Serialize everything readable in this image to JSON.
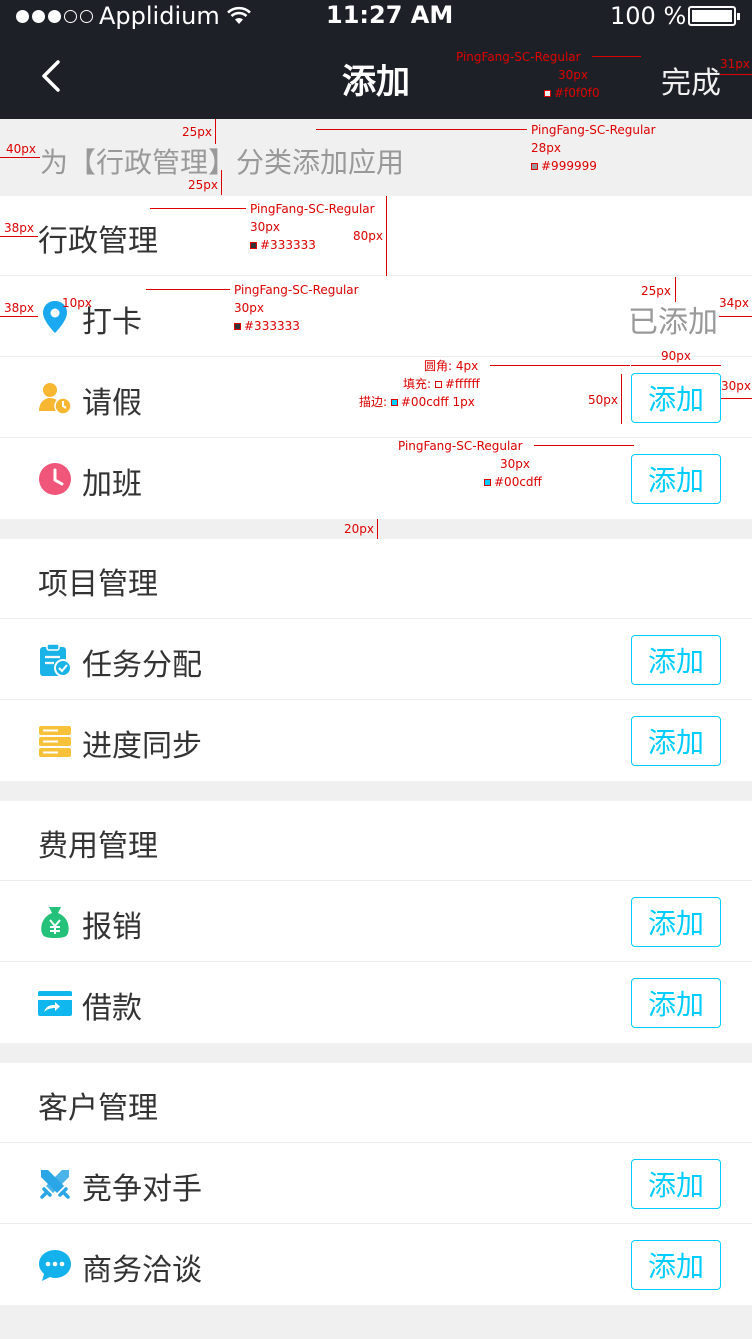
{
  "status": {
    "carrier": "Applidium",
    "time": "11:27 AM",
    "battery": "100 %"
  },
  "nav": {
    "title": "添加",
    "done": "完成"
  },
  "hint": "为【行政管理】分类添加应用",
  "colors": {
    "accent": "#00cdff",
    "text": "#333333",
    "muted": "#999999",
    "navbar": "#1e2027",
    "background": "#f0f0f0"
  },
  "sections": [
    {
      "title": "行政管理",
      "items": [
        {
          "label": "打卡",
          "icon": "location-pin-icon",
          "action": "已添加"
        },
        {
          "label": "请假",
          "icon": "person-clock-icon",
          "action": "添加"
        },
        {
          "label": "加班",
          "icon": "clock-icon",
          "action": "添加"
        }
      ]
    },
    {
      "title": "项目管理",
      "items": [
        {
          "label": "任务分配",
          "icon": "clipboard-check-icon",
          "action": "添加"
        },
        {
          "label": "进度同步",
          "icon": "server-stack-icon",
          "action": "添加"
        }
      ]
    },
    {
      "title": "费用管理",
      "items": [
        {
          "label": "报销",
          "icon": "money-bag-icon",
          "action": "添加"
        },
        {
          "label": "借款",
          "icon": "card-icon",
          "action": "添加"
        }
      ]
    },
    {
      "title": "客户管理",
      "items": [
        {
          "label": "竞争对手",
          "icon": "crossed-swords-icon",
          "action": "添加"
        },
        {
          "label": "商务洽谈",
          "icon": "chat-bubble-icon",
          "action": "添加"
        }
      ]
    }
  ],
  "annotations": {
    "font": "PingFang-SC-Regular",
    "done_size": "30px",
    "done_color": "#f0f0f0",
    "hint_size": "28px",
    "hint_color": "#999999",
    "head_size": "30px",
    "head_color": "#333333",
    "item_size": "30px",
    "item_color": "#333333",
    "btn_text_size": "30px",
    "btn_text_color": "#00cdff",
    "radius": "圆角: 4px",
    "fill": "填充:",
    "fill_color": "#ffffff",
    "stroke": "描边:",
    "stroke_color": "#00cdff 1px",
    "d40": "40px",
    "d25a": "25px",
    "d25b": "25px",
    "d38a": "38px",
    "d38b": "38px",
    "d80": "80px",
    "d10": "10px",
    "d25c": "25px",
    "d34": "34px",
    "d31": "31px",
    "d90": "90px",
    "d50": "50px",
    "d30": "30px",
    "d20": "20px"
  }
}
